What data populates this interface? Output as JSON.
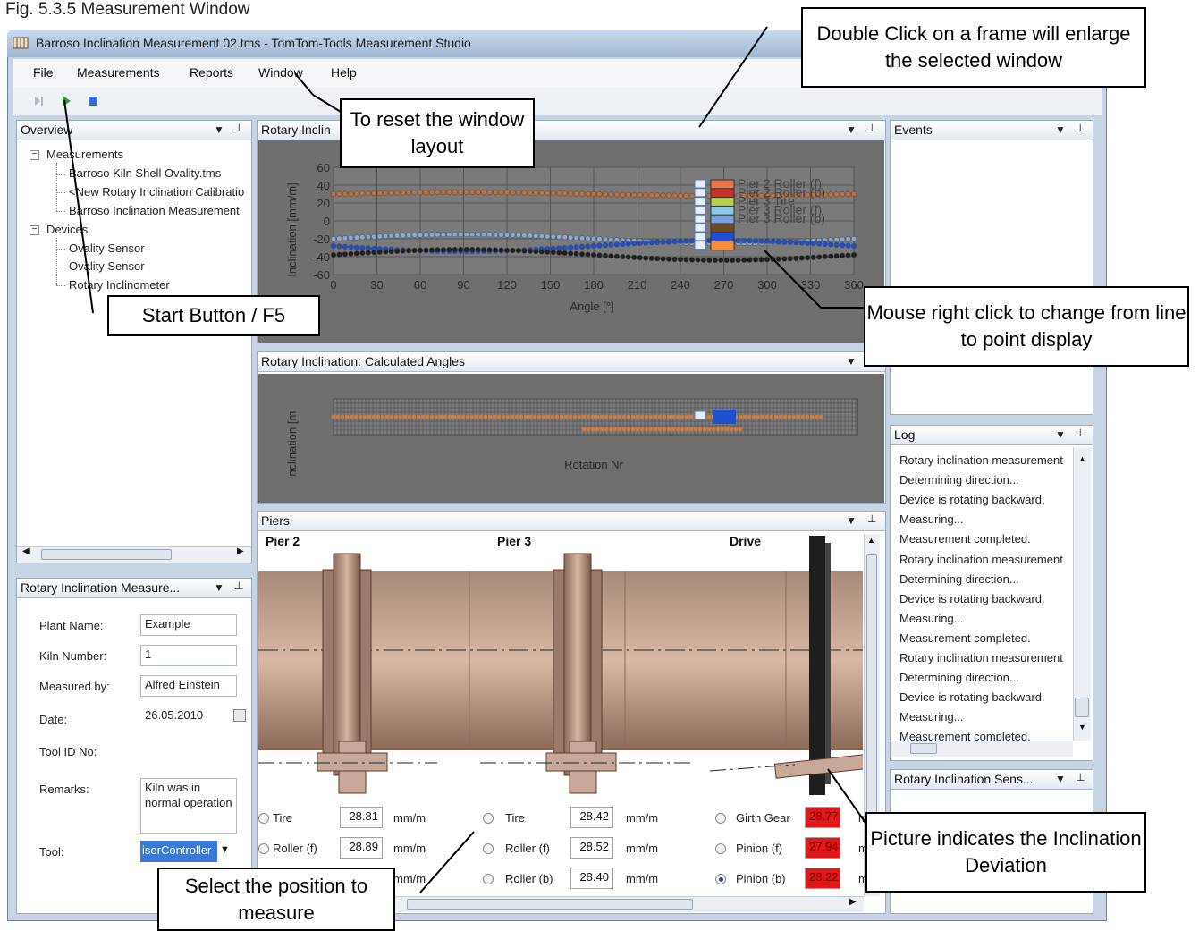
{
  "caption": "Fig. 5.3.5 Measurement Window",
  "window": {
    "title": "Barroso Inclination Measurement 02.tms - TomTom-Tools Measurement Studio"
  },
  "menu": [
    "File",
    "Measurements",
    "Reports",
    "Window",
    "Help"
  ],
  "toolbar": {
    "icons": [
      "step-forward-icon",
      "play-icon",
      "stop-icon"
    ]
  },
  "overview": {
    "title": "Overview",
    "measurements_label": "Measurements",
    "measurements": [
      "Barroso Kiln Shell Ovality.tms",
      "<New Rotary Inclination Calibratio",
      "Barroso Inclination Measurement"
    ],
    "devices_label": "Devices",
    "devices": [
      "Ovality Sensor",
      "Ovality Sensor",
      "Rotary Inclinometer"
    ]
  },
  "chart1": {
    "title_visible": "Rotary Inclin",
    "ylabel": "Inclination [mm/m]",
    "xlabel": "Angle [°]",
    "yticks": [
      "60",
      "40",
      "20",
      "0",
      "-20",
      "-40",
      "-60"
    ],
    "xticks": [
      "0",
      "30",
      "60",
      "90",
      "120",
      "150",
      "180",
      "210",
      "240",
      "270",
      "300",
      "330",
      "360"
    ],
    "legend": [
      "Pier 2 Roller (f)",
      "Pier 2 Roller (b)",
      "Pier 3 Tire",
      "Pier 3 Roller (f)",
      "Pier 3 Roller (b)",
      "",
      ""
    ],
    "legend_colors": [
      "#e8764a",
      "#c83020",
      "#b5d04a",
      "#8ec8e8",
      "#7aa0e0",
      "#6b4a2a",
      "#1f4fd0",
      "#ff8a3a"
    ]
  },
  "chart2": {
    "title": "Rotary Inclination: Calculated Angles",
    "ylabel": "Inclination [m",
    "xlabel": "Rotation Nr"
  },
  "piers": {
    "title": "Piers",
    "headers": [
      "Pier 2",
      "Pier 3",
      "Drive"
    ],
    "col1": [
      {
        "label": "Tire",
        "value": "28.81",
        "unit": "mm/m"
      },
      {
        "label": "Roller (f)",
        "value": "28.89",
        "unit": "mm/m"
      },
      {
        "label": "",
        "value": "",
        "unit": "mm/m"
      }
    ],
    "col2": [
      {
        "label": "Tire",
        "value": "28.42",
        "unit": "mm/m"
      },
      {
        "label": "Roller (f)",
        "value": "28.52",
        "unit": "mm/m"
      },
      {
        "label": "Roller (b)",
        "value": "28.40",
        "unit": "mm/m"
      }
    ],
    "col3": [
      {
        "label": "Girth Gear",
        "value": "28.77",
        "unit": "m"
      },
      {
        "label": "Pinion (f)",
        "value": "27.94",
        "unit": "m"
      },
      {
        "label": "Pinion (b)",
        "value": "28.22",
        "unit": "m"
      }
    ]
  },
  "events": {
    "title": "Events"
  },
  "log": {
    "title": "Log",
    "lines": [
      "Rotary inclination measurement",
      "Determining direction...",
      "Device is rotating backward.",
      "Measuring...",
      "Measurement completed.",
      "Rotary inclination measurement",
      "Determining direction...",
      "Device is rotating backward.",
      "Measuring...",
      "Measurement completed.",
      "Rotary inclination measurement",
      "Determining direction...",
      "Device is rotating backward.",
      "Measuring...",
      "Measurement completed."
    ]
  },
  "sensor_panel": {
    "title": "Rotary Inclination Sens..."
  },
  "props": {
    "title": "Rotary Inclination Measure...",
    "fields": [
      {
        "label": "Plant Name:",
        "value": "Example"
      },
      {
        "label": "Kiln Number:",
        "value": "1"
      },
      {
        "label": "Measured by:",
        "value": "Alfred Einstein"
      },
      {
        "label": "Date:",
        "value": "26.05.2010"
      },
      {
        "label": "Tool ID No:",
        "value": ""
      },
      {
        "label": "Remarks:",
        "value": "Kiln was in normal operation"
      },
      {
        "label": "Tool:",
        "value": "isorController"
      }
    ]
  },
  "callouts": {
    "double_click": "Double Click on a frame will enlarge the selected window",
    "reset_layout": "To reset the window layout",
    "start_button": "Start Button / F5",
    "right_click": "Mouse right click to change from line to point display",
    "picture_indicates": "Picture indicates the Inclination Deviation",
    "select_position": "Select the position to measure"
  }
}
